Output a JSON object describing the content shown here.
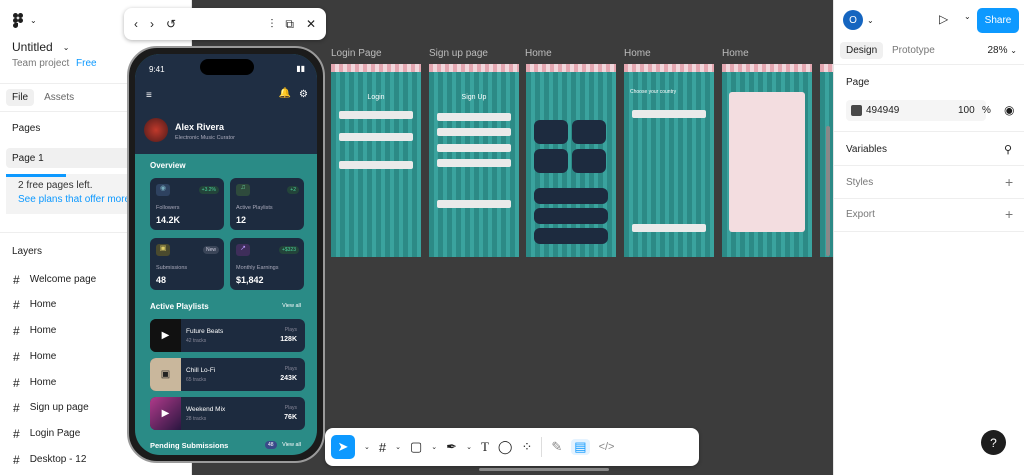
{
  "left_panel": {
    "file_title": "Untitled",
    "team": "Team project",
    "plan": "Free",
    "tabs": [
      "File",
      "Assets"
    ],
    "pages_heading": "Pages",
    "current_page": "Page 1",
    "notice_text": "2 free pages left.",
    "notice_link": "See plans that offer more",
    "layers_heading": "Layers",
    "layers": [
      "Welcome page",
      "Home",
      "Home",
      "Home",
      "Home",
      "Sign up page",
      "Login Page",
      "Desktop - 12"
    ]
  },
  "right_panel": {
    "avatar_letter": "O",
    "share_label": "Share",
    "tabs": [
      "Design",
      "Prototype"
    ],
    "zoom": "28%",
    "page_heading": "Page",
    "bg_color": "494949",
    "bg_opacity": "100",
    "bg_opacity_unit": "%",
    "variables": "Variables",
    "styles": "Styles",
    "export": "Export",
    "help": "?"
  },
  "canvas": {
    "frame_labels": [
      "Login Page",
      "Sign up page",
      "Home",
      "Home",
      "Home"
    ],
    "login_title": "Login",
    "signup_title": "Sign Up",
    "country_title": "Choose your country"
  },
  "phone": {
    "time": "9:41",
    "user_name": "Alex Rivera",
    "user_role": "Electronic Music Curator",
    "overview_heading": "Overview",
    "stats": [
      {
        "label": "Followers",
        "value": "14.2K",
        "delta": "+3.2%"
      },
      {
        "label": "Active Playlists",
        "value": "12",
        "delta": "+2"
      },
      {
        "label": "Submissions",
        "value": "48",
        "delta": "New"
      },
      {
        "label": "Monthly Earnings",
        "value": "$1,842",
        "delta": "+$323"
      }
    ],
    "playlists_heading": "Active Playlists",
    "view_all": "View all",
    "playlists": [
      {
        "name": "Future Beats",
        "tracks": "42 tracks",
        "plays_label": "Plays",
        "plays": "128K"
      },
      {
        "name": "Chill Lo-Fi",
        "tracks": "65 tracks",
        "plays_label": "Plays",
        "plays": "243K"
      },
      {
        "name": "Weekend Mix",
        "tracks": "28 tracks",
        "plays_label": "Plays",
        "plays": "76K"
      }
    ],
    "pending_heading": "Pending Submissions",
    "pending_count": "48",
    "pending_view_all": "View all"
  },
  "colors": {
    "accent": "#0d99ff",
    "phone_bg": "#2a8b86",
    "card": "#1d2b3f"
  }
}
